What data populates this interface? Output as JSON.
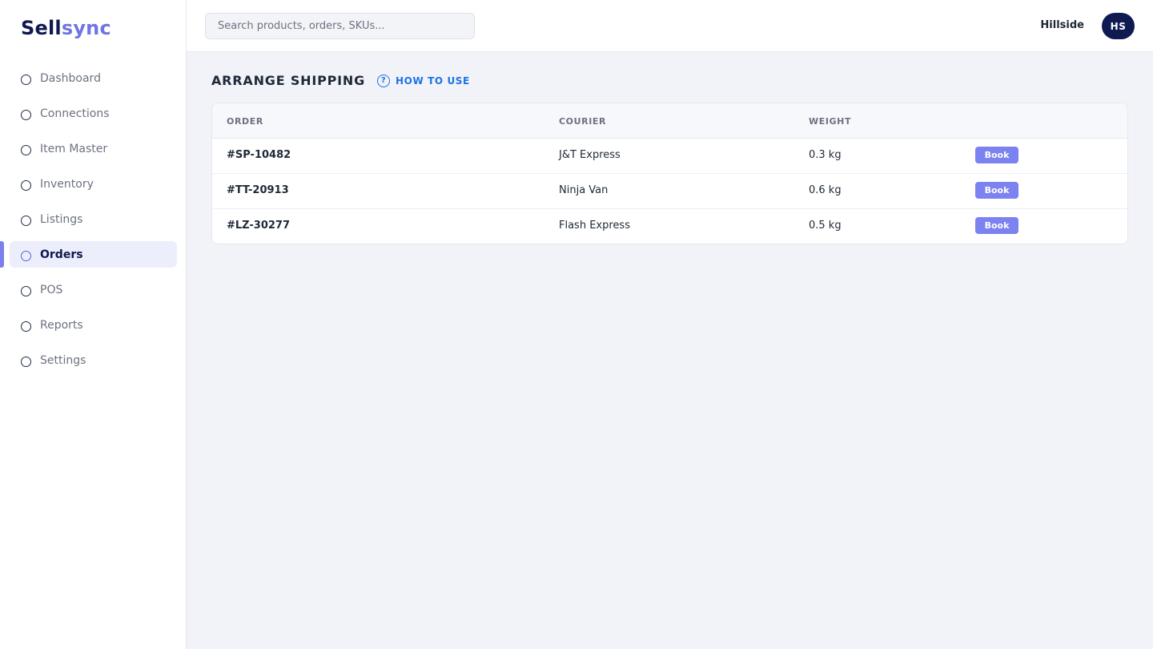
{
  "app": {
    "logo_part1": "Sell",
    "logo_part2": "sync",
    "brand_color": "#10184f",
    "accent_color": "#6f75e3"
  },
  "sidebar": {
    "items": [
      {
        "label": "Dashboard",
        "active": false
      },
      {
        "label": "Connections",
        "active": false
      },
      {
        "label": "Item Master",
        "active": false
      },
      {
        "label": "Inventory",
        "active": false
      },
      {
        "label": "Listings",
        "active": false
      },
      {
        "label": "Orders",
        "active": true
      },
      {
        "label": "POS",
        "active": false
      },
      {
        "label": "Reports",
        "active": false
      },
      {
        "label": "Settings",
        "active": false
      }
    ]
  },
  "header": {
    "search_placeholder": "Search products, orders, SKUs...",
    "user_name": "Hillside",
    "avatar_initials": "HS"
  },
  "main": {
    "title": "ARRANGE SHIPPING",
    "help_label": "HOW TO USE",
    "help_icon": "question-circle-icon",
    "table": {
      "columns": [
        "ORDER",
        "COURIER",
        "WEIGHT",
        ""
      ],
      "rows": [
        {
          "order": "#SP-10482",
          "courier": "J&T Express",
          "weight": "0.3 kg",
          "action": "Book"
        },
        {
          "order": "#TT-20913",
          "courier": "Ninja Van",
          "weight": "0.6 kg",
          "action": "Book"
        },
        {
          "order": "#LZ-30277",
          "courier": "Flash Express",
          "weight": "0.5 kg",
          "action": "Book"
        }
      ]
    }
  }
}
